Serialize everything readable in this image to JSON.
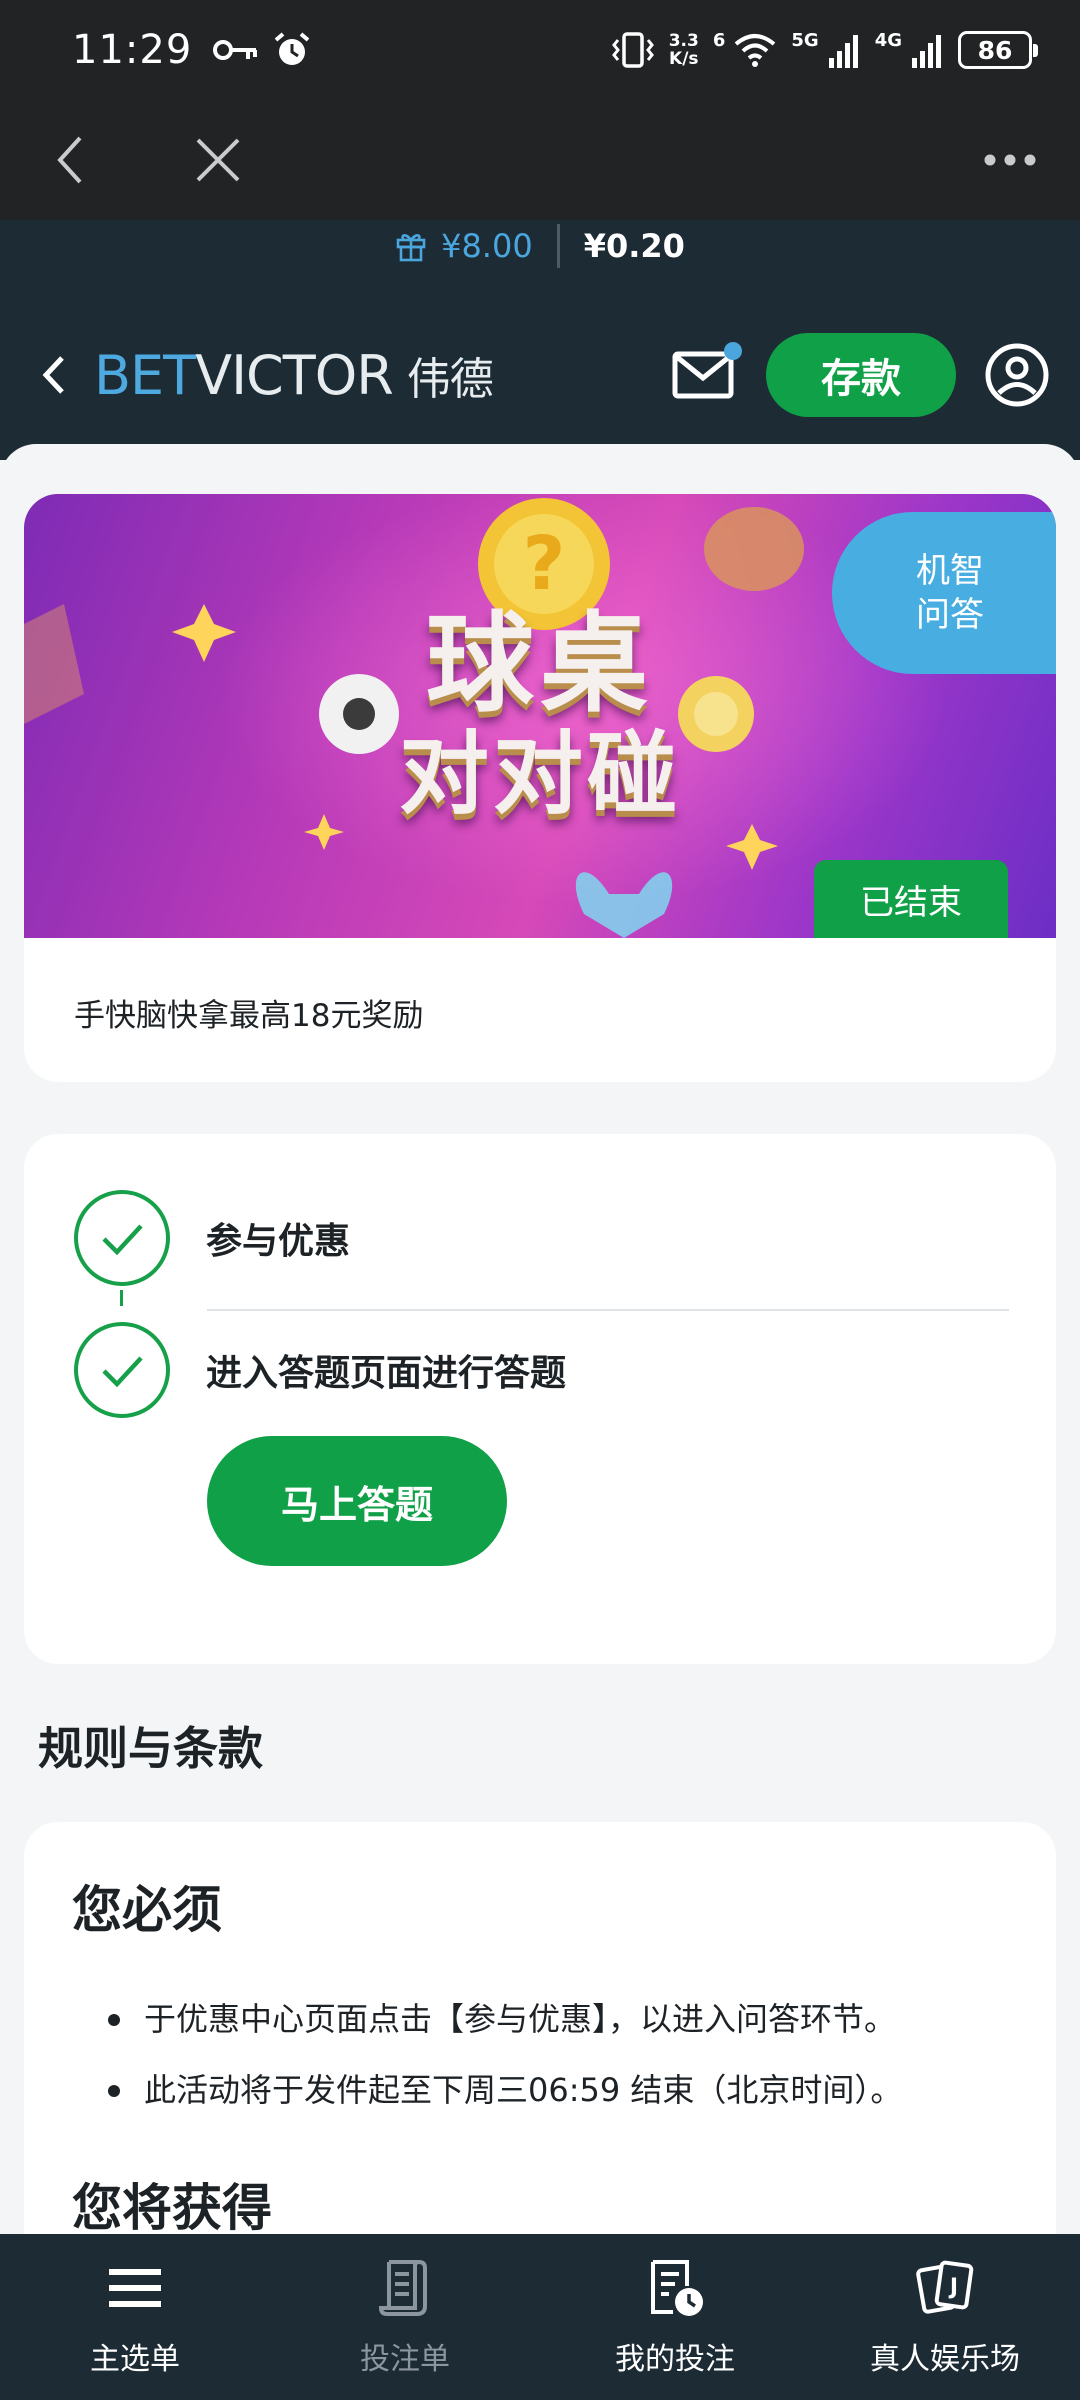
{
  "status_bar": {
    "time": "11:29",
    "speed_value": "3.3",
    "speed_unit": "K/s",
    "wifi_label": "6",
    "net1": "5G",
    "net2": "4G",
    "battery": "86"
  },
  "browser": {
    "back_icon": "chevron-left-icon",
    "close_icon": "close-icon",
    "more_icon": "more-horizontal-icon"
  },
  "header": {
    "bonus_balance": "¥8.00",
    "cash_balance": "¥0.20",
    "brand_bet": "BET",
    "brand_victor": "VICTOR",
    "brand_cn": "伟德",
    "deposit_label": "存款",
    "colors": {
      "brand_blue": "#4ea9e0",
      "header_bg": "#1d2b35",
      "accent_green": "#10a048"
    }
  },
  "promo": {
    "banner_line1": "球桌",
    "banner_line2": "对对碰",
    "tag": "机智\n问答",
    "tag_line1": "机智",
    "tag_line2": "问答",
    "status": "已结束",
    "description": "手快脑快拿最高18元奖励"
  },
  "steps": {
    "items": [
      {
        "label": "参与优惠",
        "done": true
      },
      {
        "label": "进入答题页面进行答题",
        "done": true
      }
    ],
    "cta_label": "马上答题"
  },
  "rules": {
    "heading": "规则与条款",
    "must_heading": "您必须",
    "must_items": [
      "于优惠中心页面点击【参与优惠】，以进入问答环节。",
      "此活动将于发件起至下周三06:59 结束（北京时间）。"
    ],
    "get_heading": "您将获得"
  },
  "bottom_nav": {
    "items": [
      {
        "label": "主选单",
        "icon": "menu-icon"
      },
      {
        "label": "投注单",
        "icon": "betslip-icon"
      },
      {
        "label": "我的投注",
        "icon": "my-bets-icon"
      },
      {
        "label": "真人娱乐场",
        "icon": "live-casino-icon"
      }
    ]
  }
}
